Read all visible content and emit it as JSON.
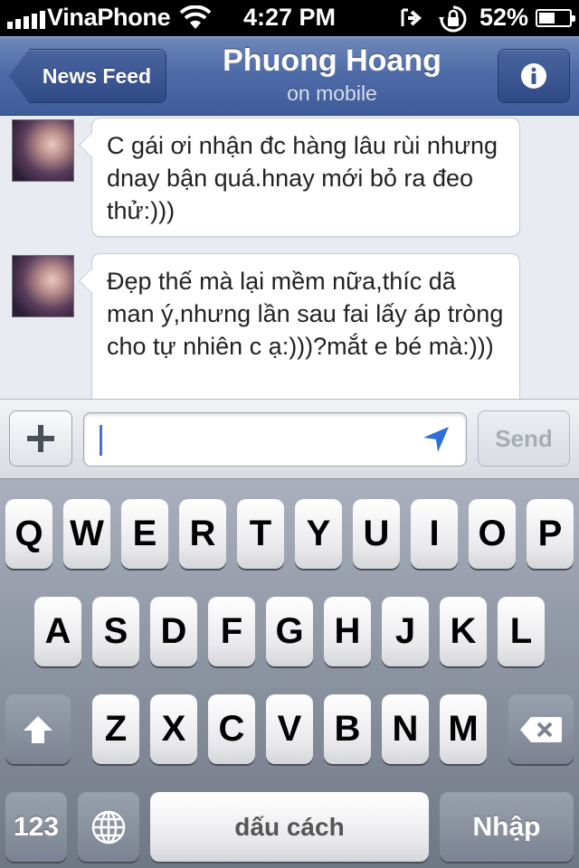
{
  "status_bar": {
    "carrier": "VinaPhone",
    "time": "4:27 PM",
    "battery": "52%",
    "battery_level": 0.52,
    "icons": [
      "signal-icon",
      "wifi-icon",
      "location-icon",
      "rotation-lock-icon",
      "battery-icon"
    ]
  },
  "nav": {
    "back_label": "News Feed",
    "title": "Phuong Hoang",
    "subtitle": "on mobile",
    "info_icon": "info-icon"
  },
  "messages": [
    {
      "text": "C gái ơi nhận đc hàng lâu rùi nhưng dnay bận quá.hnay mới bỏ ra đeo thử:)))"
    },
    {
      "text": "Đẹp thế mà lại mềm nữa,thíc dã man ý,nhưng lần sau fai lấy áp tròng cho tự nhiên c ạ:)))?mắt e bé mà:)))"
    }
  ],
  "composer": {
    "plus_icon": "plus-icon",
    "input_value": "",
    "location_icon": "location-arrow-icon",
    "send_label": "Send"
  },
  "keyboard": {
    "row1": [
      "Q",
      "W",
      "E",
      "R",
      "T",
      "Y",
      "U",
      "I",
      "O",
      "P"
    ],
    "row2": [
      "A",
      "S",
      "D",
      "F",
      "G",
      "H",
      "J",
      "K",
      "L"
    ],
    "row3": [
      "Z",
      "X",
      "C",
      "V",
      "B",
      "N",
      "M"
    ],
    "numbers_label": "123",
    "space_label": "dấu cách",
    "return_label": "Nhập",
    "shift_icon": "shift-icon",
    "delete_icon": "delete-icon",
    "globe_icon": "globe-icon",
    "colors": {
      "keyboard_bg": "#8e95a3",
      "key_bg": "#ffffff",
      "nav_bg": "#4e6aa6"
    }
  }
}
